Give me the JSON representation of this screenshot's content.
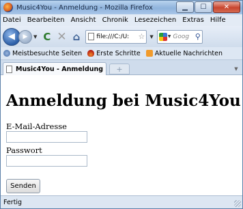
{
  "window": {
    "title": "Music4You - Anmeldung - Mozilla Firefox",
    "controls": {
      "minimize": "▁",
      "maximize": "☐",
      "close": "✕"
    }
  },
  "menu": [
    "Datei",
    "Bearbeiten",
    "Ansicht",
    "Chronik",
    "Lesezeichen",
    "Extras",
    "Hilfe"
  ],
  "toolbar": {
    "url": "file:///C:/U:",
    "search_placeholder": "Goog",
    "icons": {
      "back": "◀",
      "forward": "▶",
      "reload": "C",
      "stop": "✕",
      "home": "⌂",
      "star": "☆",
      "search": "⚲"
    }
  },
  "bookmarks": [
    "Meistbesuchte Seiten",
    "Erste Schritte",
    "Aktuelle Nachrichten"
  ],
  "tabs": [
    {
      "label": "Music4You - Anmeldung",
      "active": true
    }
  ],
  "tab_new": "+",
  "page": {
    "heading": "Anmeldung bei Music4You",
    "email_label": "E-Mail-Adresse",
    "email_value": "",
    "password_label": "Passwort",
    "password_value": "",
    "submit_label": "Senden"
  },
  "status": {
    "text": "Fertig"
  },
  "colors": {
    "frame": "#5a7fa8",
    "close_button": "#c8452e",
    "toolbar": "#dce6f2"
  }
}
